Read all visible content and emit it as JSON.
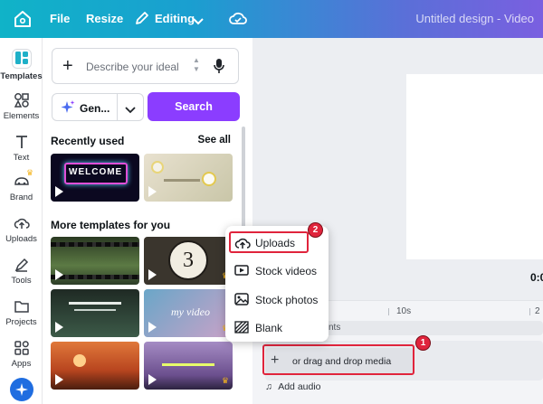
{
  "topbar": {
    "file_label": "File",
    "resize_label": "Resize",
    "editing_label": "Editing",
    "title": "Untitled design - Video"
  },
  "rail": {
    "items": [
      {
        "label": "Templates"
      },
      {
        "label": "Elements"
      },
      {
        "label": "Text"
      },
      {
        "label": "Brand"
      },
      {
        "label": "Uploads"
      },
      {
        "label": "Tools"
      },
      {
        "label": "Projects"
      },
      {
        "label": "Apps"
      }
    ]
  },
  "panel": {
    "search_placeholder": "Describe your ideal",
    "generate_label": "Gen...",
    "search_button": "Search",
    "recently_used": "Recently used",
    "see_all": "See all",
    "more_templates": "More templates for you"
  },
  "popup": {
    "items": [
      {
        "label": "Uploads"
      },
      {
        "label": "Stock videos"
      },
      {
        "label": "Stock photos"
      },
      {
        "label": "Blank"
      }
    ]
  },
  "timeline": {
    "ruler": [
      "10s",
      "2"
    ],
    "timecode": "0:0",
    "drop_label": "or drag and drop media",
    "add_audio": "Add audio",
    "hint_text": "nts"
  },
  "badges": {
    "one": "1",
    "two": "2"
  },
  "thumb_text": {
    "welcome": "WELCOME",
    "countdown": "3",
    "my_video": "my video"
  },
  "colors": {
    "accent": "#8b3dff",
    "annotation": "#e0243c",
    "crown": "#f5b51e"
  }
}
